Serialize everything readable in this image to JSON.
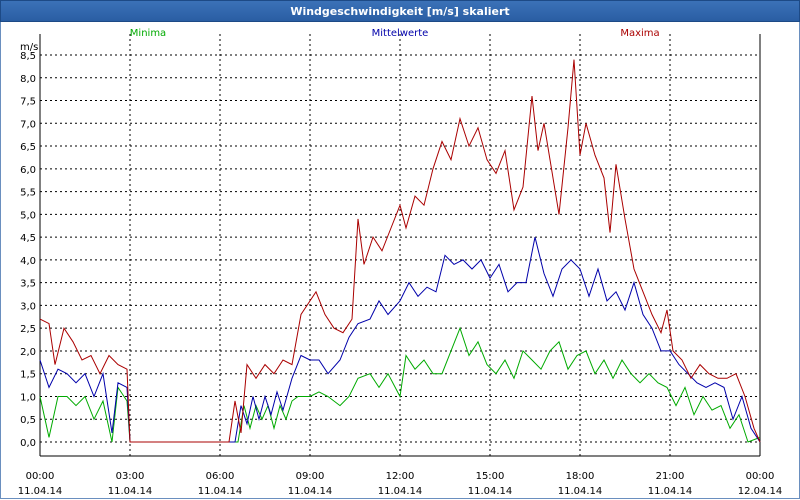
{
  "window_title": "Windgeschwindigkeit [m/s] skaliert",
  "chart_data": {
    "type": "line",
    "title": "Windgeschwindigkeit [m/s] skaliert",
    "ylabel": "m/s",
    "ylim": [
      0,
      8.5
    ],
    "y_ticks": [
      "0,0",
      "0,5",
      "1,0",
      "1,5",
      "2,0",
      "2,5",
      "3,0",
      "3,5",
      "4,0",
      "4,5",
      "5,0",
      "5,5",
      "6,0",
      "6,5",
      "7,0",
      "7,5",
      "8,0",
      "8,5"
    ],
    "xlim_hours": [
      0,
      24
    ],
    "x_ticks": [
      {
        "time": "00:00",
        "date": "11.04.14"
      },
      {
        "time": "03:00",
        "date": "11.04.14"
      },
      {
        "time": "06:00",
        "date": "11.04.14"
      },
      {
        "time": "09:00",
        "date": "11.04.14"
      },
      {
        "time": "12:00",
        "date": "11.04.14"
      },
      {
        "time": "15:00",
        "date": "11.04.14"
      },
      {
        "time": "18:00",
        "date": "11.04.14"
      },
      {
        "time": "21:00",
        "date": "11.04.14"
      },
      {
        "time": "00:00",
        "date": "12.04.14"
      }
    ],
    "grid": true,
    "legend_position": "top",
    "series": [
      {
        "name": "Minima",
        "color": "#00aa00",
        "points": [
          [
            0.0,
            1.0
          ],
          [
            0.3,
            0.1
          ],
          [
            0.6,
            1.0
          ],
          [
            0.9,
            1.0
          ],
          [
            1.2,
            0.8
          ],
          [
            1.5,
            1.0
          ],
          [
            1.8,
            0.5
          ],
          [
            2.1,
            0.9
          ],
          [
            2.4,
            0.0
          ],
          [
            2.6,
            1.2
          ],
          [
            2.9,
            0.9
          ],
          [
            3.0,
            0.0
          ],
          [
            6.6,
            0.0
          ],
          [
            6.8,
            0.8
          ],
          [
            7.0,
            0.3
          ],
          [
            7.2,
            0.8
          ],
          [
            7.4,
            0.5
          ],
          [
            7.6,
            0.8
          ],
          [
            7.8,
            0.3
          ],
          [
            8.0,
            0.8
          ],
          [
            8.2,
            0.5
          ],
          [
            8.4,
            0.9
          ],
          [
            8.6,
            1.0
          ],
          [
            8.8,
            1.0
          ],
          [
            9.0,
            1.0
          ],
          [
            9.3,
            1.1
          ],
          [
            9.6,
            1.0
          ],
          [
            10.0,
            0.8
          ],
          [
            10.3,
            1.0
          ],
          [
            10.6,
            1.4
          ],
          [
            11.0,
            1.5
          ],
          [
            11.3,
            1.2
          ],
          [
            11.6,
            1.5
          ],
          [
            12.0,
            1.0
          ],
          [
            12.2,
            1.9
          ],
          [
            12.5,
            1.6
          ],
          [
            12.8,
            1.8
          ],
          [
            13.1,
            1.5
          ],
          [
            13.4,
            1.5
          ],
          [
            13.7,
            2.0
          ],
          [
            14.0,
            2.5
          ],
          [
            14.3,
            1.9
          ],
          [
            14.6,
            2.2
          ],
          [
            14.9,
            1.7
          ],
          [
            15.2,
            1.5
          ],
          [
            15.5,
            1.8
          ],
          [
            15.8,
            1.4
          ],
          [
            16.1,
            2.0
          ],
          [
            16.4,
            1.8
          ],
          [
            16.7,
            1.6
          ],
          [
            17.0,
            2.0
          ],
          [
            17.3,
            2.2
          ],
          [
            17.6,
            1.6
          ],
          [
            17.9,
            1.9
          ],
          [
            18.2,
            2.0
          ],
          [
            18.5,
            1.5
          ],
          [
            18.8,
            1.8
          ],
          [
            19.1,
            1.4
          ],
          [
            19.4,
            1.8
          ],
          [
            19.7,
            1.5
          ],
          [
            20.0,
            1.3
          ],
          [
            20.3,
            1.5
          ],
          [
            20.6,
            1.3
          ],
          [
            20.9,
            1.2
          ],
          [
            21.2,
            0.8
          ],
          [
            21.5,
            1.2
          ],
          [
            21.8,
            0.6
          ],
          [
            22.1,
            1.0
          ],
          [
            22.4,
            0.7
          ],
          [
            22.7,
            0.8
          ],
          [
            23.0,
            0.3
          ],
          [
            23.3,
            0.6
          ],
          [
            23.6,
            0.0
          ],
          [
            24.0,
            0.1
          ]
        ]
      },
      {
        "name": "Mittelwerte",
        "color": "#0000aa",
        "points": [
          [
            0.0,
            1.8
          ],
          [
            0.3,
            1.2
          ],
          [
            0.6,
            1.6
          ],
          [
            0.9,
            1.5
          ],
          [
            1.2,
            1.3
          ],
          [
            1.5,
            1.5
          ],
          [
            1.8,
            1.0
          ],
          [
            2.1,
            1.5
          ],
          [
            2.4,
            0.2
          ],
          [
            2.6,
            1.3
          ],
          [
            2.9,
            1.2
          ],
          [
            3.0,
            0.0
          ],
          [
            6.5,
            0.0
          ],
          [
            6.7,
            0.8
          ],
          [
            6.9,
            0.4
          ],
          [
            7.1,
            1.0
          ],
          [
            7.3,
            0.5
          ],
          [
            7.5,
            1.0
          ],
          [
            7.7,
            0.6
          ],
          [
            7.9,
            1.1
          ],
          [
            8.1,
            0.7
          ],
          [
            8.4,
            1.4
          ],
          [
            8.7,
            1.9
          ],
          [
            9.0,
            1.8
          ],
          [
            9.3,
            1.8
          ],
          [
            9.6,
            1.5
          ],
          [
            10.0,
            1.8
          ],
          [
            10.3,
            2.3
          ],
          [
            10.6,
            2.6
          ],
          [
            11.0,
            2.7
          ],
          [
            11.3,
            3.1
          ],
          [
            11.6,
            2.8
          ],
          [
            12.0,
            3.1
          ],
          [
            12.3,
            3.5
          ],
          [
            12.6,
            3.2
          ],
          [
            12.9,
            3.4
          ],
          [
            13.2,
            3.3
          ],
          [
            13.5,
            4.1
          ],
          [
            13.8,
            3.9
          ],
          [
            14.1,
            4.0
          ],
          [
            14.4,
            3.8
          ],
          [
            14.7,
            4.0
          ],
          [
            15.0,
            3.6
          ],
          [
            15.3,
            3.9
          ],
          [
            15.6,
            3.3
          ],
          [
            15.9,
            3.5
          ],
          [
            16.2,
            3.5
          ],
          [
            16.5,
            4.5
          ],
          [
            16.8,
            3.7
          ],
          [
            17.1,
            3.2
          ],
          [
            17.4,
            3.8
          ],
          [
            17.7,
            4.0
          ],
          [
            18.0,
            3.8
          ],
          [
            18.3,
            3.2
          ],
          [
            18.6,
            3.8
          ],
          [
            18.9,
            3.1
          ],
          [
            19.2,
            3.3
          ],
          [
            19.5,
            2.9
          ],
          [
            19.8,
            3.5
          ],
          [
            20.1,
            2.8
          ],
          [
            20.4,
            2.5
          ],
          [
            20.7,
            2.0
          ],
          [
            21.0,
            2.0
          ],
          [
            21.3,
            1.7
          ],
          [
            21.6,
            1.5
          ],
          [
            21.9,
            1.3
          ],
          [
            22.2,
            1.2
          ],
          [
            22.5,
            1.3
          ],
          [
            22.8,
            1.2
          ],
          [
            23.1,
            0.5
          ],
          [
            23.4,
            1.0
          ],
          [
            23.7,
            0.3
          ],
          [
            24.0,
            0.0
          ]
        ]
      },
      {
        "name": "Maxima",
        "color": "#aa0000",
        "points": [
          [
            0.0,
            2.7
          ],
          [
            0.3,
            2.6
          ],
          [
            0.5,
            1.7
          ],
          [
            0.8,
            2.5
          ],
          [
            1.1,
            2.2
          ],
          [
            1.4,
            1.8
          ],
          [
            1.7,
            1.9
          ],
          [
            2.0,
            1.5
          ],
          [
            2.3,
            1.9
          ],
          [
            2.6,
            1.7
          ],
          [
            2.9,
            1.6
          ],
          [
            3.0,
            0.0
          ],
          [
            6.3,
            0.0
          ],
          [
            6.5,
            0.9
          ],
          [
            6.7,
            0.2
          ],
          [
            6.9,
            1.7
          ],
          [
            7.2,
            1.4
          ],
          [
            7.5,
            1.7
          ],
          [
            7.8,
            1.5
          ],
          [
            8.1,
            1.8
          ],
          [
            8.4,
            1.7
          ],
          [
            8.7,
            2.8
          ],
          [
            9.0,
            3.1
          ],
          [
            9.2,
            3.3
          ],
          [
            9.5,
            2.8
          ],
          [
            9.8,
            2.5
          ],
          [
            10.1,
            2.4
          ],
          [
            10.4,
            2.7
          ],
          [
            10.6,
            4.9
          ],
          [
            10.8,
            3.9
          ],
          [
            11.1,
            4.5
          ],
          [
            11.4,
            4.2
          ],
          [
            11.7,
            4.7
          ],
          [
            12.0,
            5.2
          ],
          [
            12.2,
            4.7
          ],
          [
            12.5,
            5.4
          ],
          [
            12.8,
            5.2
          ],
          [
            13.1,
            6.0
          ],
          [
            13.4,
            6.6
          ],
          [
            13.7,
            6.2
          ],
          [
            14.0,
            7.1
          ],
          [
            14.3,
            6.5
          ],
          [
            14.6,
            6.9
          ],
          [
            14.9,
            6.2
          ],
          [
            15.2,
            5.9
          ],
          [
            15.5,
            6.4
          ],
          [
            15.8,
            5.1
          ],
          [
            16.1,
            5.6
          ],
          [
            16.4,
            7.6
          ],
          [
            16.6,
            6.4
          ],
          [
            16.8,
            7.0
          ],
          [
            17.0,
            6.2
          ],
          [
            17.3,
            5.0
          ],
          [
            17.6,
            6.9
          ],
          [
            17.8,
            8.4
          ],
          [
            18.0,
            6.3
          ],
          [
            18.2,
            7.0
          ],
          [
            18.5,
            6.3
          ],
          [
            18.8,
            5.8
          ],
          [
            19.0,
            4.6
          ],
          [
            19.2,
            6.1
          ],
          [
            19.5,
            4.9
          ],
          [
            19.8,
            3.8
          ],
          [
            20.1,
            3.3
          ],
          [
            20.4,
            2.8
          ],
          [
            20.7,
            2.4
          ],
          [
            20.9,
            2.9
          ],
          [
            21.1,
            2.0
          ],
          [
            21.4,
            1.8
          ],
          [
            21.7,
            1.4
          ],
          [
            22.0,
            1.7
          ],
          [
            22.3,
            1.5
          ],
          [
            22.6,
            1.4
          ],
          [
            22.9,
            1.4
          ],
          [
            23.2,
            1.5
          ],
          [
            23.5,
            1.0
          ],
          [
            23.8,
            0.3
          ],
          [
            24.0,
            0.0
          ]
        ]
      }
    ]
  }
}
